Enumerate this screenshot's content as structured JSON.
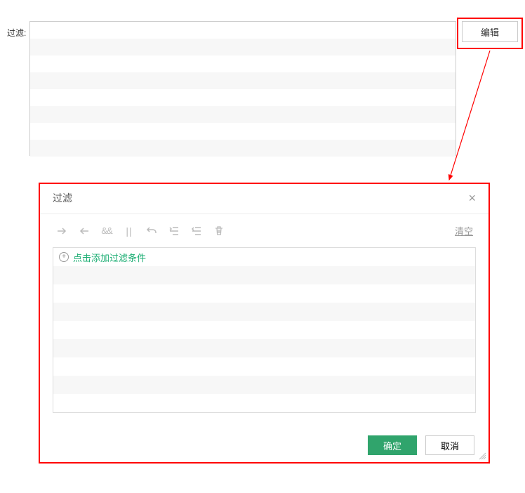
{
  "top": {
    "label": "过滤:",
    "edit_button": "编辑"
  },
  "dialog": {
    "title": "过滤",
    "toolbar": {
      "icons": [
        "arrow-right",
        "arrow-left",
        "and",
        "parallel",
        "undo",
        "indent",
        "outdent",
        "delete"
      ],
      "clear": "清空"
    },
    "add_condition_text": "点击添加过滤条件",
    "footer": {
      "confirm": "确定",
      "cancel": "取消"
    }
  },
  "colors": {
    "primary": "#30a46c",
    "highlight": "#ff0000",
    "link_green": "#1aad72"
  }
}
